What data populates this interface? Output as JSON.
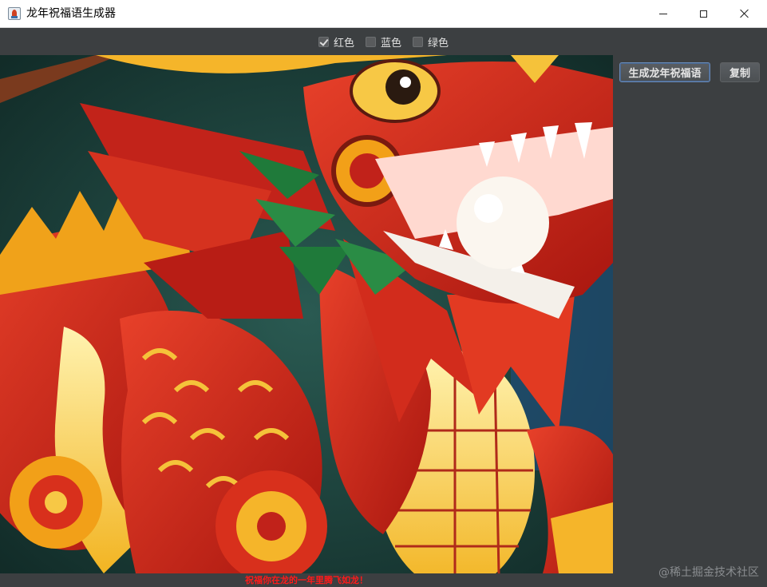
{
  "window": {
    "title": "龙年祝福语生成器",
    "icon": "java-app-icon"
  },
  "options": {
    "colors": [
      {
        "label": "红色",
        "checked": true
      },
      {
        "label": "蓝色",
        "checked": false
      },
      {
        "label": "绿色",
        "checked": false
      }
    ]
  },
  "image": {
    "subject": "dragon-lantern-image"
  },
  "buttons": {
    "generate_label": "生成龙年祝福语",
    "copy_label": "复制"
  },
  "status": {
    "blessing_text": "祝福你在龙的一年里腾飞如龙！",
    "color": "#ff1a1a"
  },
  "watermark": "@稀土掘金技术社区",
  "theme": {
    "background": "#3c3f41",
    "accent": "#6a8bb8"
  }
}
